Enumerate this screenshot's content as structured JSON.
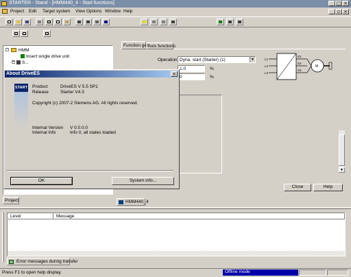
{
  "window": {
    "title": "STARTER - Stand - [HMM440_4 - Start functions]"
  },
  "menubar": {
    "items": [
      "Project",
      "Edit",
      "Target system",
      "View",
      "Options",
      "Window",
      "Help"
    ]
  },
  "tree": {
    "root": "HMM",
    "items": [
      "Insert single drive unit",
      "S..."
    ]
  },
  "tabs": {
    "tab1": "Function gen",
    "tab2": "Axis functions"
  },
  "form": {
    "label1": "Operation",
    "select1": "Dyna. start (Starter) (1)",
    "label2": "",
    "value2": "1.0",
    "unit2": "%",
    "value3": "0",
    "unit3": "%"
  },
  "diagram": {
    "labels": [
      "L1",
      "L2",
      "L3",
      "S1",
      "S2",
      "S3",
      "M"
    ]
  },
  "dialog": {
    "title": "About DriveES",
    "fields": [
      {
        "label": "Product",
        "value": "DriveES   V 5.5 SP1"
      },
      {
        "label": "Release",
        "value": "Starter   V4.3"
      }
    ],
    "copyright": "Copyright (c) 2007-2 Siemens AG. All rights reserved.",
    "internal": [
      {
        "label": "Internal Version",
        "value": "V 0.0.0.0"
      },
      {
        "label": "Internal Info",
        "value": "Info 0, all states loaded"
      }
    ],
    "ok": "OK",
    "sysinfo": "System info..."
  },
  "main_buttons": {
    "close": "Close",
    "help": "Help"
  },
  "project_tab": "Project",
  "document_tab": "HMM440_4",
  "bottom_table": {
    "columns": [
      "Level",
      "Message"
    ]
  },
  "bottom_tab": "Error messages during transfer",
  "status": {
    "left": "Press F1 to open help display.",
    "mode": "Offline mode"
  },
  "colors": {
    "title_start": "#0a246a",
    "title_end": "#a6caf0",
    "desktop": "#d4d0c8",
    "status_mode": "#0000a8"
  }
}
